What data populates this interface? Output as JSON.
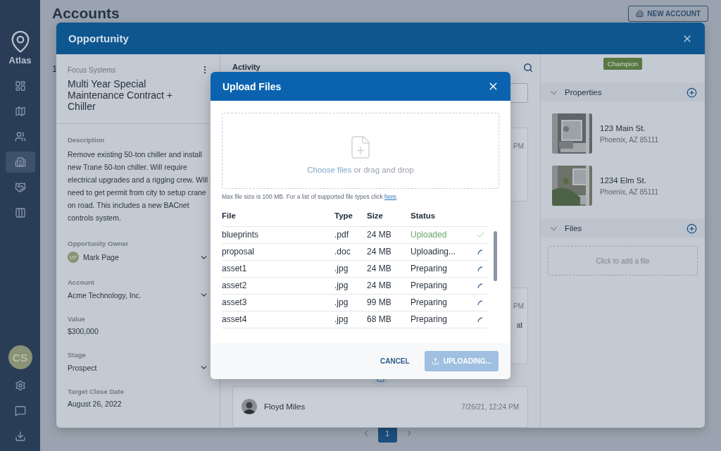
{
  "sidebar": {
    "brand": "Atlas",
    "items": [
      {
        "kind": "dashboard",
        "selected": false
      },
      {
        "kind": "map",
        "selected": false
      },
      {
        "kind": "people",
        "selected": false
      },
      {
        "kind": "building",
        "selected": true
      },
      {
        "kind": "handshake",
        "selected": false
      },
      {
        "kind": "columns",
        "selected": false
      }
    ],
    "avatar": "CS",
    "bottom_items": [
      {
        "kind": "settings"
      },
      {
        "kind": "chat"
      },
      {
        "kind": "download"
      }
    ]
  },
  "page": {
    "title": "Accounts",
    "new_account": "NEW ACCOUNT",
    "row_fragment": "1",
    "pages": [
      {
        "label": "1",
        "selected": true
      }
    ]
  },
  "opportunity": {
    "title": "Opportunity",
    "company": "Focus Systems",
    "name": "Multi Year Special Maintenance Contract + Chiller",
    "fields": [
      {
        "kind": "paragraph",
        "label": "Description",
        "value": "Remove existing 50-ton chiller and install new Trane 50-ton chiller. Will require electrical upgrades and a rigging crew. Will need to get permit from city to setup crane on road. This includes a new BACnet controls system."
      },
      {
        "kind": "select",
        "label": "Opportunity Owner",
        "value": "Mark Page",
        "avatar": "MP"
      },
      {
        "kind": "select",
        "label": "Account",
        "value": "Acme Technology, Inc."
      },
      {
        "kind": "text",
        "label": "Value",
        "value": "$300,000"
      },
      {
        "kind": "select",
        "label": "Stage",
        "value": "Prospect"
      },
      {
        "kind": "text",
        "label": "Target Close Date",
        "value": "August 26, 2022"
      }
    ],
    "activity": {
      "title": "Activity",
      "cards": [
        {
          "time": "PM"
        },
        {
          "time": "PM",
          "body": "at"
        }
      ],
      "entry": {
        "author": "Floyd Miles",
        "time": "7/26/21, 12:24 PM"
      }
    },
    "badge": "Champion",
    "properties": {
      "title": "Properties",
      "items": [
        {
          "street": "123 Main St.",
          "city": "Phoenix, AZ 85111",
          "kind": "picture"
        },
        {
          "street": "1234 Elm St.",
          "city": "Phoenix, AZ 85111",
          "kind": "picture"
        }
      ]
    },
    "files": {
      "title": "Files",
      "empty": "Click to add a file"
    }
  },
  "upload": {
    "title": "Upload Files",
    "drop_link": "Choose files",
    "drop_text": "or drag and drop",
    "note": "Max file size is 100 MB. For a list of supported file types click",
    "note_link": "here",
    "note_end": ".",
    "columns": [
      "File",
      "Type",
      "Size",
      "Status"
    ],
    "rows": [
      {
        "file": "blueprints",
        "type": ".pdf",
        "size": "24 MB",
        "status": "Uploaded",
        "kind": "done"
      },
      {
        "file": "proposal",
        "type": ".doc",
        "size": "24 MB",
        "status": "Uploading...",
        "kind": "pending"
      },
      {
        "file": "asset1",
        "type": ".jpg",
        "size": "24 MB",
        "status": "Preparing",
        "kind": "pending"
      },
      {
        "file": "asset2",
        "type": ".jpg",
        "size": "24 MB",
        "status": "Preparing",
        "kind": "pending"
      },
      {
        "file": "asset3",
        "type": ".jpg",
        "size": "99 MB",
        "status": "Preparing",
        "kind": "pending"
      },
      {
        "file": "asset4",
        "type": ".jpg",
        "size": "68 MB",
        "status": "Preparing",
        "kind": "pending"
      }
    ],
    "cancel": "CANCEL",
    "submit": {
      "label": "UPLOADING...",
      "disabled": true
    }
  }
}
